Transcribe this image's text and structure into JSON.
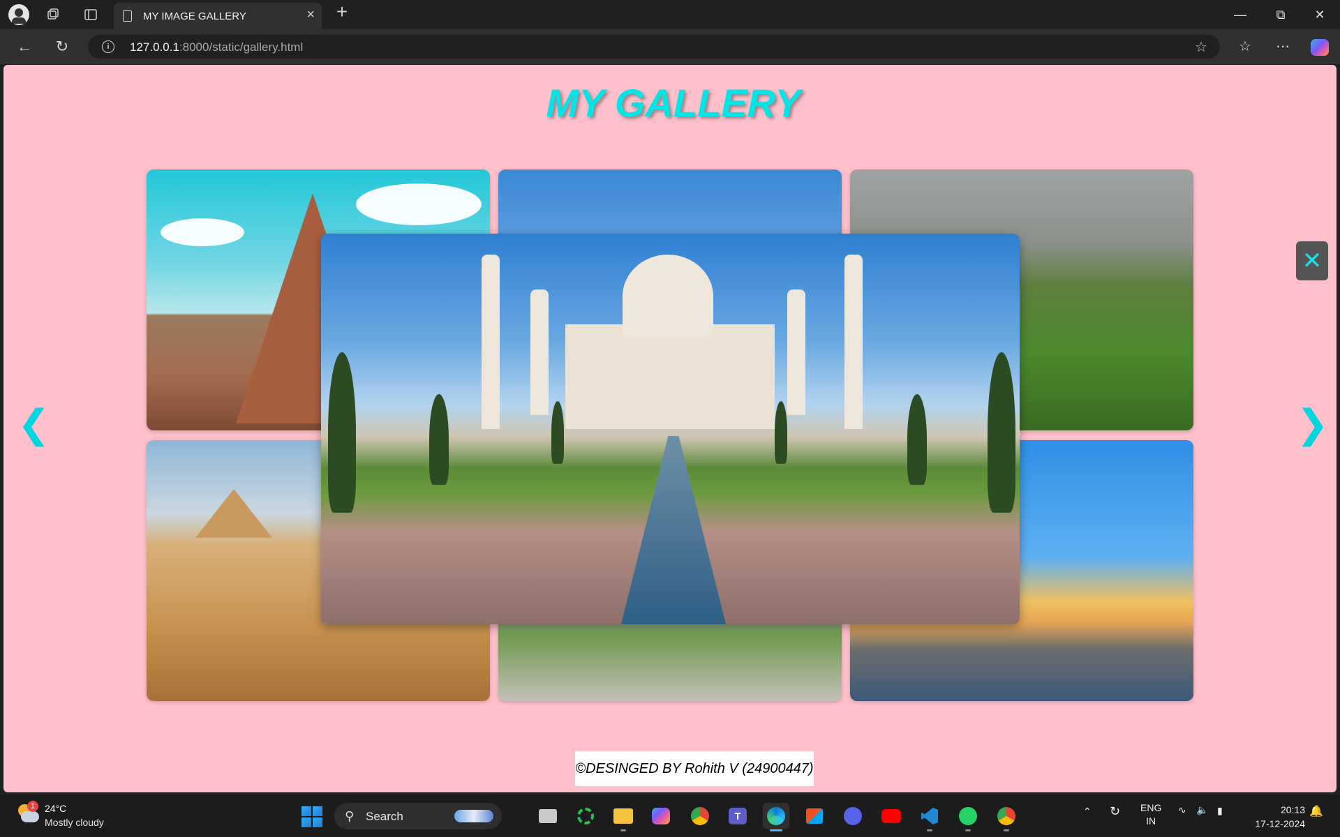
{
  "browser": {
    "tab_title": "MY IMAGE GALLERY",
    "url_host": "127.0.0.1",
    "url_rest": ":8000/static/gallery.html"
  },
  "page": {
    "heading": "MY GALLERY",
    "footer": "©DESINGED BY Rohith V (24900447)",
    "lightbox": {
      "close_symbol": "✕",
      "prev_symbol": "❮",
      "next_symbol": "❯",
      "image": "taj-mahal"
    },
    "gallery_images": [
      "temple",
      "taj-mahal",
      "great-wall",
      "sphinx-pyramid",
      "eiffel-tower",
      "harbour-city"
    ]
  },
  "taskbar": {
    "weather_temp": "24°C",
    "weather_cond": "Mostly cloudy",
    "weather_badge": "1",
    "search_label": "Search",
    "lang_top": "ENG",
    "lang_bottom": "IN",
    "time": "20:13",
    "date": "17-12-2024"
  },
  "colors": {
    "page_bg": "#ffc0cb",
    "accent_cyan": "#00e5e5",
    "close_bg": "#555555"
  }
}
